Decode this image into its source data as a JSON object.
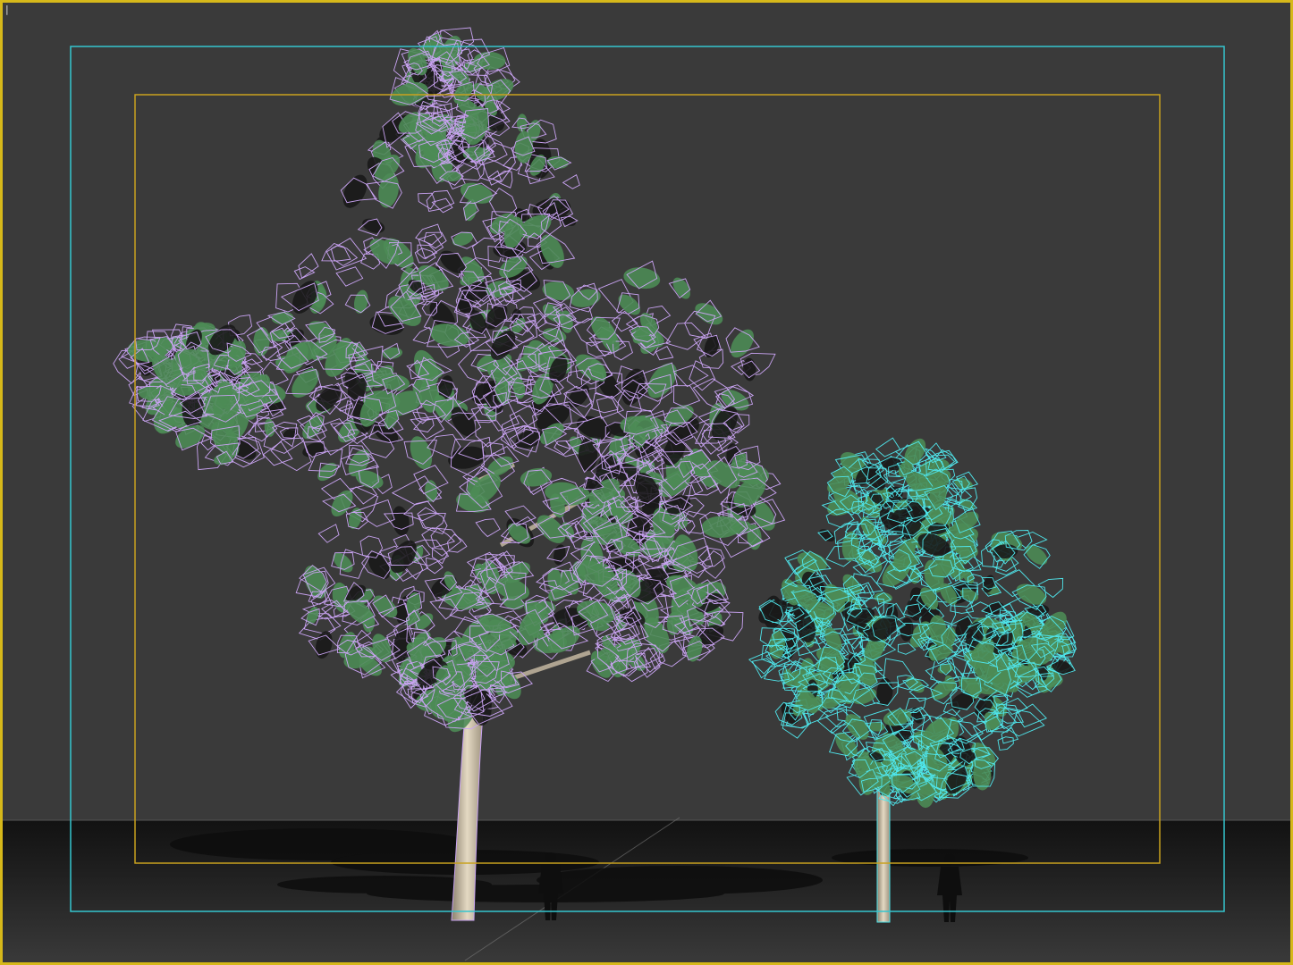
{
  "viewport": {
    "active_label": "|"
  },
  "colors": {
    "background": "#3a3a3a",
    "ground": "#1e1e1e",
    "viewport_active_border": "#d6b81a",
    "safe_frame_outer": "#35c6cf",
    "safe_frame_inner": "#c9a21e",
    "tree_large_wire": "#c9a3f2",
    "tree_small_wire": "#4fe6ec",
    "leaf_fill": "#4d8b55",
    "trunk": "#cdbfa8"
  },
  "objects": [
    {
      "name": "tree-large",
      "selected": false,
      "wire_color": "lilac"
    },
    {
      "name": "tree-small",
      "selected": true,
      "wire_color": "cyan"
    },
    {
      "name": "human-figure-scale-1"
    },
    {
      "name": "human-figure-scale-2"
    }
  ]
}
